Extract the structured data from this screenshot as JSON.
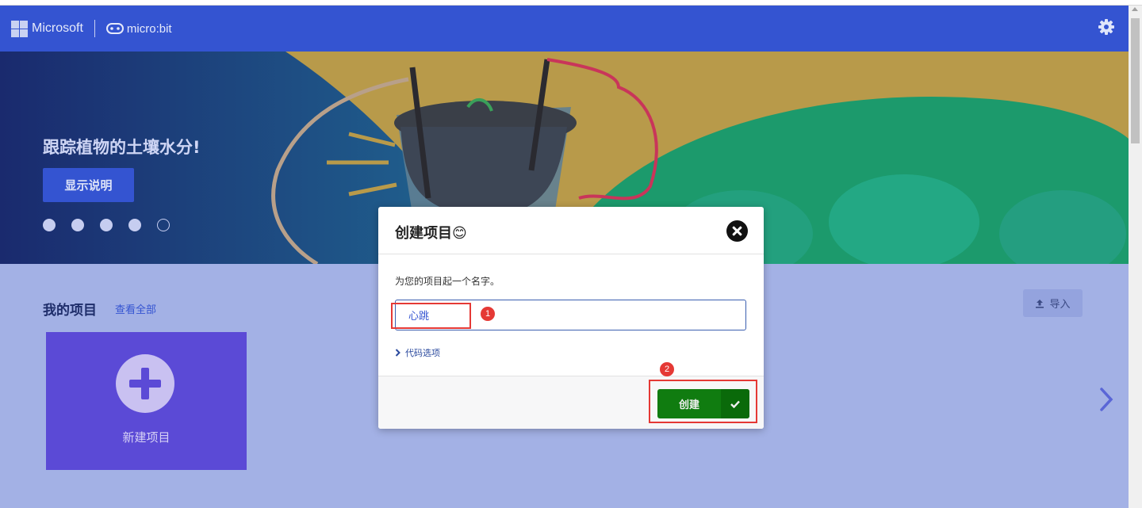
{
  "header": {
    "microsoft_label": "Microsoft",
    "product_label": "micro:bit",
    "settings_icon": "gear-icon"
  },
  "hero": {
    "title": "跟踪植物的土壤水分!",
    "button_label": "显示说明",
    "carousel_dots": 5,
    "active_dot": 5
  },
  "projects": {
    "title": "我的项目",
    "view_all": "查看全部",
    "import_label": "导入",
    "new_project_label": "新建项目"
  },
  "modal": {
    "title": "创建项目😊",
    "prompt": "为您的项目起一个名字。",
    "name_value": "心跳",
    "code_options_label": "代码选项",
    "create_label": "创建"
  },
  "annotations": {
    "badge_1": "1",
    "badge_2": "2"
  },
  "colors": {
    "header": "#3454d1",
    "main_bg": "#a3b1e5",
    "new_card": "#5b4ad6",
    "create_button": "#107c10",
    "annotation": "#e53935"
  }
}
